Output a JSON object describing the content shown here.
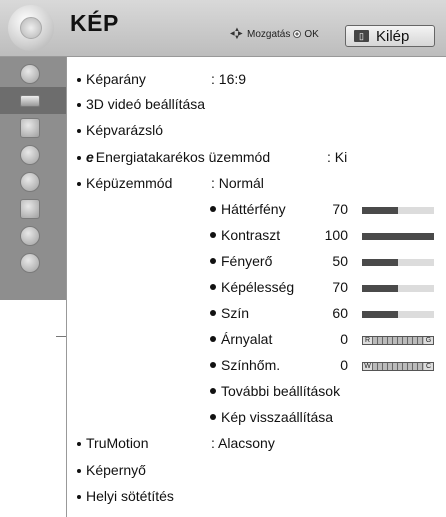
{
  "header": {
    "title": "KÉP",
    "nav_hint": "Mozgatás",
    "ok_label": "OK",
    "exit_label": "Kilép"
  },
  "menu": {
    "kepa_ratio": {
      "label": "Képarány",
      "value": ": 16:9"
    },
    "video3d": {
      "label": "3D videó beállítása"
    },
    "wizard": {
      "label": "Képvarázsló"
    },
    "energy": {
      "icon": "e",
      "label": "Energiatakarékos üzemmód",
      "value": ": Ki"
    },
    "picture_mode": {
      "label": "Képüzemmód",
      "value": ": Normál"
    },
    "settings": [
      {
        "label": "Háttérfény",
        "value": "70",
        "level": 0.5
      },
      {
        "label": "Kontraszt",
        "value": "100",
        "level": 1.0
      },
      {
        "label": "Fényerő",
        "value": "50",
        "level": 0.5
      },
      {
        "label": "Képélesség",
        "value": "70",
        "level": 0.5
      },
      {
        "label": "Szín",
        "value": "60",
        "level": 0.5
      }
    ],
    "tint": {
      "label": "Árnyalat",
      "value": "0",
      "left": "R",
      "right": "G"
    },
    "color_temp": {
      "label": "Színhőm.",
      "value": "0",
      "left": "W",
      "right": "C"
    },
    "more_settings": {
      "label": "További beállítások"
    },
    "reset": {
      "label": "Kép visszaállítása"
    },
    "trumotion": {
      "label": "TruMotion",
      "value": ": Alacsony"
    },
    "screen": {
      "label": "Képernyő"
    },
    "local_dimming": {
      "label": "Helyi sötétítés"
    }
  },
  "sidebar": {
    "items": [
      {
        "icon": "satellite-dish-icon"
      },
      {
        "icon": "tv-picture-icon"
      },
      {
        "icon": "speaker-icon"
      },
      {
        "icon": "clock-icon"
      },
      {
        "icon": "lock-icon"
      },
      {
        "icon": "options-icon"
      },
      {
        "icon": "network-icon"
      },
      {
        "icon": "help-icon"
      }
    ],
    "selected_index": 1
  }
}
